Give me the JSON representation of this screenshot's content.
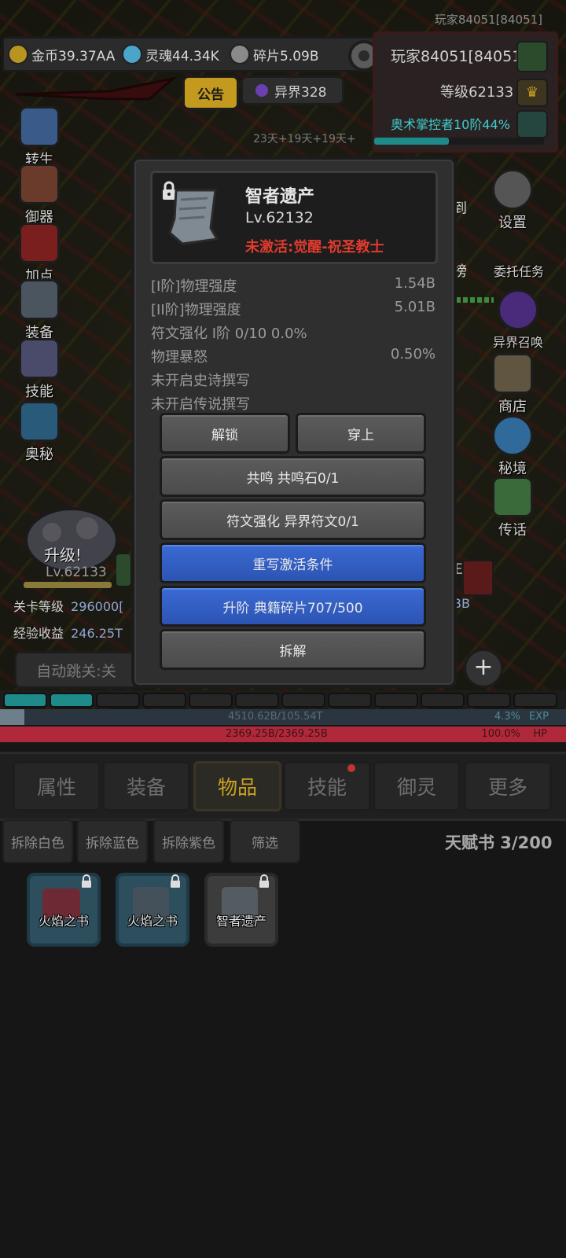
{
  "top_tag": "玩家84051[84051]",
  "resources": {
    "gold": "金币39.37AA",
    "soul": "灵魂44.34K",
    "shard": "碎片5.09B"
  },
  "player": {
    "name": "玩家84051[84051]",
    "level": "等级62133",
    "title": "奥术掌控者10阶44%"
  },
  "header_tabs": {
    "notice": "公告",
    "otherworld": "异界328"
  },
  "timers": "23天+19天+19天+",
  "left_menu": [
    "转生",
    "御器",
    "加点",
    "装备",
    "技能",
    "奥秘"
  ],
  "right_menu": {
    "settings": "设置",
    "checkin_partial": "到",
    "rank_partial": "榜",
    "quest": "委托任务",
    "summon": "异界召唤",
    "shop": "商店",
    "secret": "秘境",
    "legend": "传话"
  },
  "hero": {
    "upgrade": "升级!",
    "level": "Lv.62133"
  },
  "stage": {
    "label": "关卡等级",
    "value": "296000[",
    "exp_label": "经验收益",
    "exp_value": "246.25T",
    "auto_skip": "自动跳关:关",
    "right_partial": "BB",
    "right_partial2": "王"
  },
  "item": {
    "name": "智者遗产",
    "level": "Lv.62132",
    "condition": "未激活:觉醒-祝圣教士",
    "stats": [
      {
        "label": "[I阶]物理强度",
        "value": "1.54B"
      },
      {
        "label": "[II阶]物理强度",
        "value": "5.01B"
      },
      {
        "label": "符文强化 I阶 0/10 0.0%",
        "value": ""
      },
      {
        "label": "物理暴怒",
        "value": "0.50%"
      },
      {
        "label": "未开启史诗撰写",
        "value": ""
      },
      {
        "label": "未开启传说撰写",
        "value": ""
      }
    ],
    "buttons": {
      "unlock": "解锁",
      "equip": "穿上",
      "resonate": "共鸣 共鸣石0/1",
      "rune": "符文强化 异界符文0/1",
      "rewrite": "重写激活条件",
      "ascend": "升阶 典籍碎片707/500",
      "dismantle": "拆解"
    }
  },
  "bars": {
    "exp_text": "4510.62B/105.54T",
    "exp_pct": "4.3%",
    "exp_label": "EXP",
    "exp_fill": 0.043,
    "hp_text": "2369.25B/2369.25B",
    "hp_pct": "100.0%",
    "hp_label": "HP",
    "hp_fill": 1.0
  },
  "main_tabs": [
    "属性",
    "装备",
    "物品",
    "技能",
    "御灵",
    "更多"
  ],
  "active_tab": "物品",
  "filters": [
    "拆除白色",
    "拆除蓝色",
    "拆除紫色",
    "筛选"
  ],
  "talent_books": "天赋书 3/200",
  "inventory": [
    {
      "name": "火焰之书",
      "rarity": "blue"
    },
    {
      "name": "火焰之书",
      "rarity": "blue"
    },
    {
      "name": "智者遗产",
      "rarity": "white"
    }
  ],
  "colors": {
    "accent_gold": "#c9a225",
    "warn_red": "#e23a2e",
    "blue_button": "#3b6ad4",
    "title_cyan": "#3ecfcf",
    "hp_red": "#b0293a",
    "exp_teal": "#1f8a8a"
  }
}
